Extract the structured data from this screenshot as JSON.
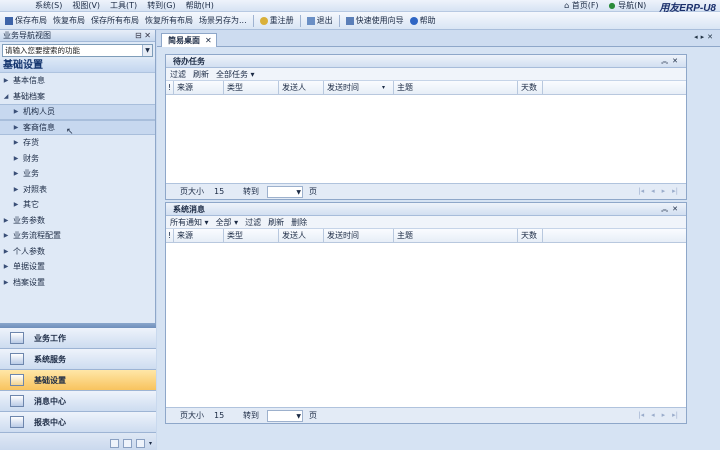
{
  "menubar": {
    "items": [
      "系统(S)",
      "视图(V)",
      "工具(T)",
      "转到(G)",
      "帮助(H)"
    ],
    "home": "首页(F)",
    "nav": "导航(N)",
    "logo": "用友ERP-U8"
  },
  "toolbar": {
    "items": [
      "保存布局",
      "恢复布局",
      "保存所有布局",
      "恢复所有布局",
      "场景另存为..."
    ],
    "items2": [
      "重注册",
      "退出",
      "快速使用向导",
      "帮助"
    ]
  },
  "nav": {
    "header": "业务导航视图",
    "search_placeholder": "请输入您要搜索的功能",
    "title": "基础设置",
    "tree": [
      {
        "label": "基本信息",
        "level": 0,
        "expanded": false
      },
      {
        "label": "基础档案",
        "level": 0,
        "expanded": true
      },
      {
        "label": "机构人员",
        "level": 1
      },
      {
        "label": "客商信息",
        "level": 1
      },
      {
        "label": "存货",
        "level": 1
      },
      {
        "label": "财务",
        "level": 1
      },
      {
        "label": "业务",
        "level": 1
      },
      {
        "label": "对照表",
        "level": 1
      },
      {
        "label": "其它",
        "level": 1
      },
      {
        "label": "业务参数",
        "level": 0,
        "expanded": false
      },
      {
        "label": "业务流程配置",
        "level": 0,
        "expanded": false
      },
      {
        "label": "个人参数",
        "level": 0,
        "expanded": false
      },
      {
        "label": "单据设置",
        "level": 0,
        "expanded": false
      },
      {
        "label": "档案设置",
        "level": 0,
        "expanded": false
      }
    ],
    "bars": [
      "业务工作",
      "系统服务",
      "基础设置",
      "消息中心",
      "报表中心"
    ],
    "active_bar": "基础设置"
  },
  "tabs": {
    "active": "简易桌面"
  },
  "tasks_panel": {
    "title": "待办任务",
    "tools": [
      "过滤",
      "刷新",
      "全部任务 ▾"
    ],
    "columns": [
      "来源",
      "类型",
      "发送人",
      "发送时间",
      "主题",
      "天数"
    ],
    "footer": {
      "page_size_label": "页大小",
      "page_size": "15",
      "goto_label": "转到",
      "page_label": "页"
    }
  },
  "messages_panel": {
    "title": "系统消息",
    "tools": [
      "所有通知 ▾",
      "全部 ▾",
      "过滤",
      "刷新",
      "删除"
    ],
    "columns": [
      "来源",
      "类型",
      "发送人",
      "发送时间",
      "主题",
      "天数"
    ],
    "footer": {
      "page_size_label": "页大小",
      "page_size": "15",
      "goto_label": "转到",
      "page_label": "页"
    }
  },
  "colors": {
    "active_bar": "#f8c35e",
    "panel_header": "#d2dff1",
    "nav_bg": "#dfe9f6"
  }
}
